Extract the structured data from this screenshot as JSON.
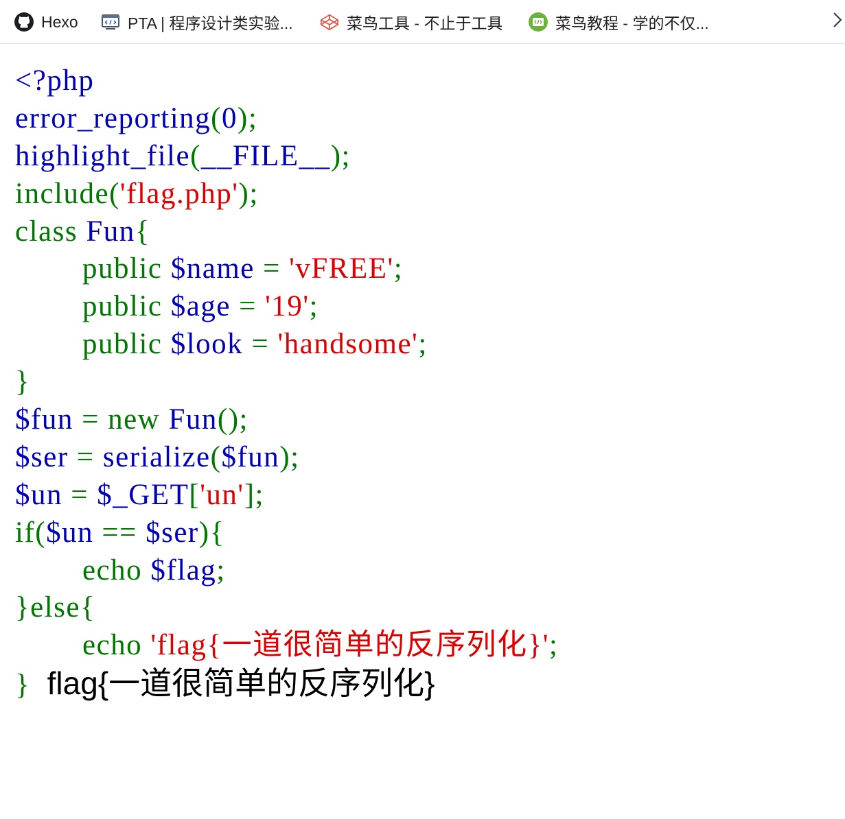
{
  "bookmarks": [
    {
      "label": "Hexo",
      "icon": "github-icon"
    },
    {
      "label": "PTA | 程序设计类实验...",
      "icon": "code-window-icon"
    },
    {
      "label": "菜鸟工具 - 不止于工具",
      "icon": "codepen-cube-icon"
    },
    {
      "label": "菜鸟教程 - 学的不仅...",
      "icon": "runoob-code-icon"
    }
  ],
  "more_icon": "chevron-right-icon",
  "colors": {
    "keyword": "#007700",
    "variable": "#0000bb",
    "string": "#dd0000",
    "output": "#000000"
  },
  "code": {
    "lines": [
      [
        {
          "t": "<?php",
          "c": "v"
        }
      ],
      [
        {
          "t": "error_reporting",
          "c": "v"
        },
        {
          "t": "(",
          "c": "k"
        },
        {
          "t": "0",
          "c": "v"
        },
        {
          "t": ");",
          "c": "k"
        }
      ],
      [
        {
          "t": "highlight_file",
          "c": "v"
        },
        {
          "t": "(",
          "c": "k"
        },
        {
          "t": "__FILE__",
          "c": "v"
        },
        {
          "t": ");",
          "c": "k"
        }
      ],
      [
        {
          "t": "include(",
          "c": "k"
        },
        {
          "t": "'flag.php'",
          "c": "s"
        },
        {
          "t": ");",
          "c": "k"
        }
      ],
      [
        {
          "t": "class ",
          "c": "k"
        },
        {
          "t": "Fun",
          "c": "v"
        },
        {
          "t": "{",
          "c": "k"
        }
      ],
      [
        {
          "t": "        public ",
          "c": "k"
        },
        {
          "t": "$name ",
          "c": "v"
        },
        {
          "t": "= ",
          "c": "k"
        },
        {
          "t": "'vFREE'",
          "c": "s"
        },
        {
          "t": ";",
          "c": "k"
        }
      ],
      [
        {
          "t": "        public ",
          "c": "k"
        },
        {
          "t": "$age ",
          "c": "v"
        },
        {
          "t": "= ",
          "c": "k"
        },
        {
          "t": "'19'",
          "c": "s"
        },
        {
          "t": ";",
          "c": "k"
        }
      ],
      [
        {
          "t": "        public ",
          "c": "k"
        },
        {
          "t": "$look ",
          "c": "v"
        },
        {
          "t": "= ",
          "c": "k"
        },
        {
          "t": "'handsome'",
          "c": "s"
        },
        {
          "t": ";",
          "c": "k"
        }
      ],
      [
        {
          "t": "}",
          "c": "k"
        }
      ],
      [
        {
          "t": "$fun ",
          "c": "v"
        },
        {
          "t": "= new ",
          "c": "k"
        },
        {
          "t": "Fun",
          "c": "v"
        },
        {
          "t": "();",
          "c": "k"
        }
      ],
      [
        {
          "t": "$ser ",
          "c": "v"
        },
        {
          "t": "= ",
          "c": "k"
        },
        {
          "t": "serialize",
          "c": "v"
        },
        {
          "t": "(",
          "c": "k"
        },
        {
          "t": "$fun",
          "c": "v"
        },
        {
          "t": ");",
          "c": "k"
        }
      ],
      [
        {
          "t": "$un ",
          "c": "v"
        },
        {
          "t": "= ",
          "c": "k"
        },
        {
          "t": "$_GET",
          "c": "v"
        },
        {
          "t": "[",
          "c": "k"
        },
        {
          "t": "'un'",
          "c": "s"
        },
        {
          "t": "];",
          "c": "k"
        }
      ],
      [
        {
          "t": "if(",
          "c": "k"
        },
        {
          "t": "$un ",
          "c": "v"
        },
        {
          "t": "== ",
          "c": "k"
        },
        {
          "t": "$ser",
          "c": "v"
        },
        {
          "t": "){",
          "c": "k"
        }
      ],
      [
        {
          "t": "        echo ",
          "c": "k"
        },
        {
          "t": "$flag",
          "c": "v"
        },
        {
          "t": ";",
          "c": "k"
        }
      ],
      [
        {
          "t": "}else{",
          "c": "k"
        }
      ],
      [
        {
          "t": "        echo ",
          "c": "k"
        },
        {
          "t": "'flag{一道很简单的反序列化}'",
          "c": "s"
        },
        {
          "t": ";",
          "c": "k"
        }
      ],
      [
        {
          "t": "}",
          "c": "k"
        }
      ]
    ]
  },
  "output": "flag{一道很简单的反序列化}"
}
